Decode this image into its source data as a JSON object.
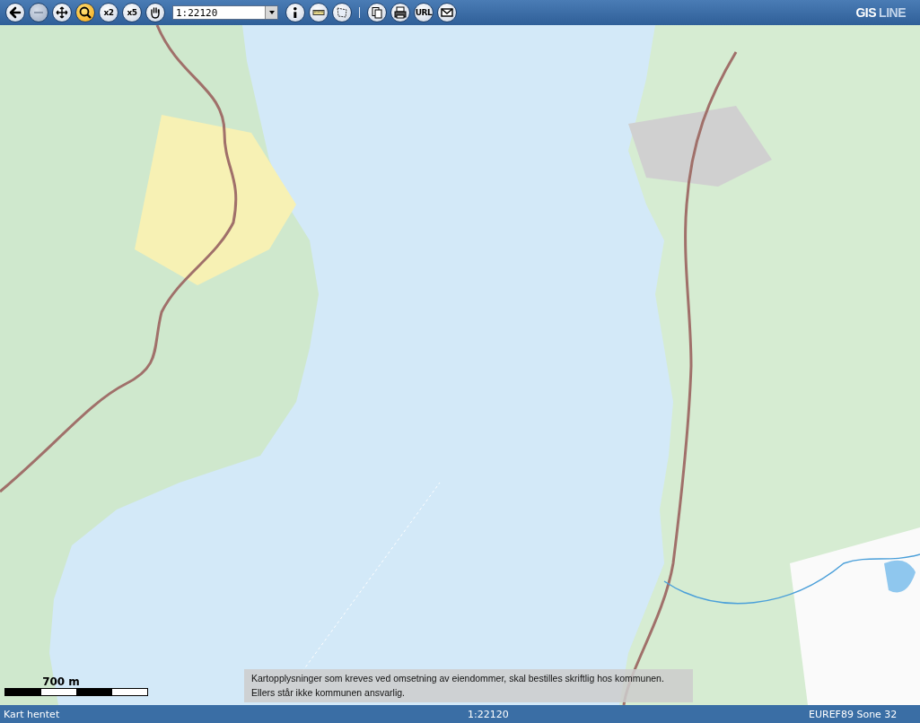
{
  "toolbar": {
    "tools": [
      {
        "kind": "back",
        "selected": false,
        "disabled": false
      },
      {
        "kind": "zoom-out",
        "selected": false,
        "disabled": true
      },
      {
        "kind": "pan",
        "selected": false,
        "disabled": false
      },
      {
        "kind": "zoom-in",
        "selected": true,
        "disabled": false
      },
      {
        "kind": "text",
        "label": "x2",
        "selected": false,
        "disabled": false
      },
      {
        "kind": "text",
        "label": "x5",
        "selected": false,
        "disabled": false
      },
      {
        "kind": "hand",
        "selected": false,
        "disabled": false
      },
      {
        "kind": "scale",
        "value": "1:22120"
      },
      {
        "kind": "info",
        "selected": false,
        "disabled": false
      },
      {
        "kind": "ruler",
        "selected": false,
        "disabled": false
      },
      {
        "kind": "area",
        "selected": false,
        "disabled": false
      },
      {
        "kind": "separator"
      },
      {
        "kind": "copy",
        "selected": false,
        "disabled": false
      },
      {
        "kind": "print",
        "selected": false,
        "disabled": false
      },
      {
        "kind": "text",
        "label": "URL",
        "selected": false,
        "disabled": false
      },
      {
        "kind": "mail",
        "selected": false,
        "disabled": false
      }
    ],
    "logo": {
      "brand": "GIS",
      "suffix": "LINE"
    }
  },
  "map": {
    "scale_bar": {
      "label": "700 m"
    },
    "notice": {
      "lines": [
        "Kartopplysninger som kreves ved omsetning av eiendommer, skal bestilles skriftlig hos kommunen.",
        "Ellers står ikke kommunen ansvarlig."
      ]
    }
  },
  "status_bar": {
    "message": "Kart hentet",
    "scale": "1:22120",
    "projection": "EUREF89 Sone 32"
  }
}
